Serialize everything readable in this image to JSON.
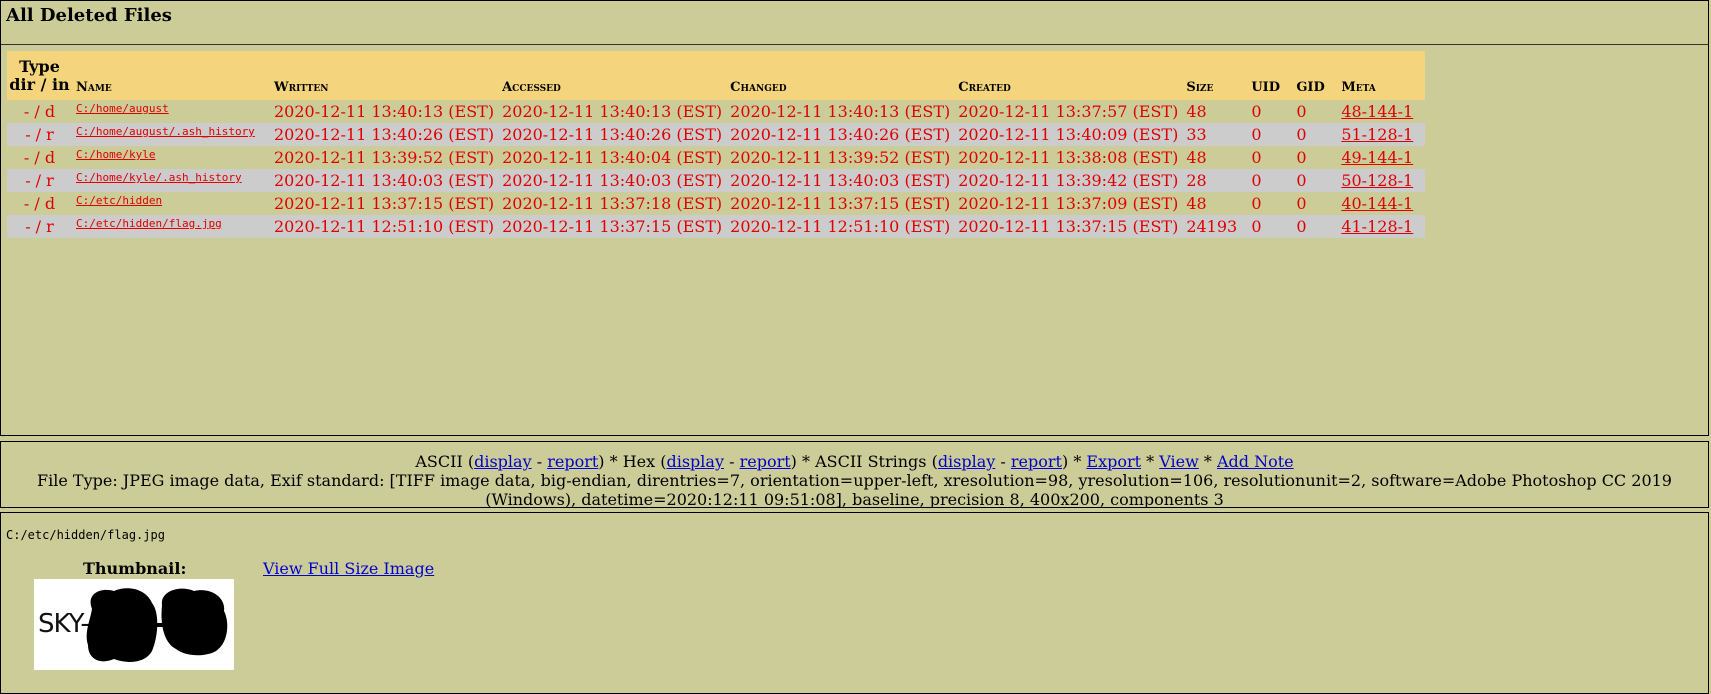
{
  "title": "All Deleted Files",
  "table": {
    "headers": {
      "type": [
        "Type",
        "dir / in"
      ],
      "name": "Name",
      "written": "Written",
      "accessed": "Accessed",
      "changed": "Changed",
      "created": "Created",
      "size": "Size",
      "uid": "UID",
      "gid": "GID",
      "meta": "Meta"
    },
    "rows": [
      {
        "type": "- / d",
        "name": "C:/home/august",
        "written": "2020-12-11 13:40:13 (EST)",
        "accessed": "2020-12-11 13:40:13 (EST)",
        "changed": "2020-12-11 13:40:13 (EST)",
        "created": "2020-12-11 13:37:57 (EST)",
        "size": "48",
        "uid": "0",
        "gid": "0",
        "meta": "48-144-1"
      },
      {
        "type": "- / r",
        "name": "C:/home/august/.ash_history",
        "written": "2020-12-11 13:40:26 (EST)",
        "accessed": "2020-12-11 13:40:26 (EST)",
        "changed": "2020-12-11 13:40:26 (EST)",
        "created": "2020-12-11 13:40:09 (EST)",
        "size": "33",
        "uid": "0",
        "gid": "0",
        "meta": "51-128-1"
      },
      {
        "type": "- / d",
        "name": "C:/home/kyle",
        "written": "2020-12-11 13:39:52 (EST)",
        "accessed": "2020-12-11 13:40:04 (EST)",
        "changed": "2020-12-11 13:39:52 (EST)",
        "created": "2020-12-11 13:38:08 (EST)",
        "size": "48",
        "uid": "0",
        "gid": "0",
        "meta": "49-144-1"
      },
      {
        "type": "- / r",
        "name": "C:/home/kyle/.ash_history",
        "written": "2020-12-11 13:40:03 (EST)",
        "accessed": "2020-12-11 13:40:03 (EST)",
        "changed": "2020-12-11 13:40:03 (EST)",
        "created": "2020-12-11 13:39:42 (EST)",
        "size": "28",
        "uid": "0",
        "gid": "0",
        "meta": "50-128-1"
      },
      {
        "type": "- / d",
        "name": "C:/etc/hidden",
        "written": "2020-12-11 13:37:15 (EST)",
        "accessed": "2020-12-11 13:37:18 (EST)",
        "changed": "2020-12-11 13:37:15 (EST)",
        "created": "2020-12-11 13:37:09 (EST)",
        "size": "48",
        "uid": "0",
        "gid": "0",
        "meta": "40-144-1"
      },
      {
        "type": "- / r",
        "name": "C:/etc/hidden/flag.jpg",
        "written": "2020-12-11 12:51:10 (EST)",
        "accessed": "2020-12-11 13:37:15 (EST)",
        "changed": "2020-12-11 12:51:10 (EST)",
        "created": "2020-12-11 13:37:15 (EST)",
        "size": "24193",
        "uid": "0",
        "gid": "0",
        "meta": "41-128-1"
      }
    ]
  },
  "toolbar": {
    "ascii": "ASCII",
    "hex": "Hex",
    "ascii_strings": "ASCII Strings",
    "display": "display",
    "report": "report",
    "export": "Export",
    "view": "View",
    "add_note": "Add Note"
  },
  "file_type": "File Type: JPEG image data, Exif standard: [TIFF image data, big-endian, direntries=7, orientation=upper-left, xresolution=98, yresolution=106, resolutionunit=2, software=Adobe Photoshop CC 2019 (Windows), datetime=2020:12:11 09:51:08], baseline, precision 8, 400x200, components 3",
  "viewer": {
    "path": "C:/etc/hidden/flag.jpg",
    "thumbnail_label": "Thumbnail:",
    "thumbnail_text": "SKY-",
    "view_full": "View Full Size Image"
  },
  "colors": {
    "background": "#cccc99",
    "header_row": "#f4d47d",
    "alt_row": "#cccccc",
    "deleted_text": "#e00000",
    "link": "#0000cc"
  }
}
